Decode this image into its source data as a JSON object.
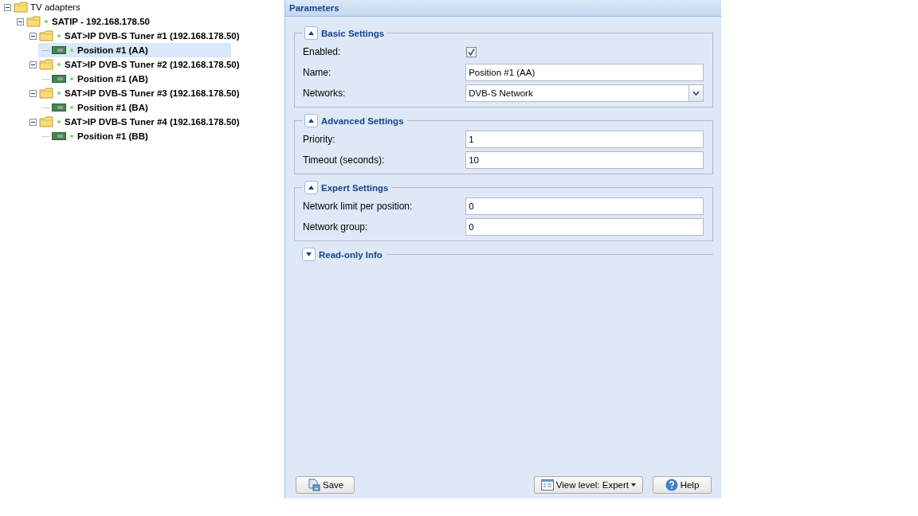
{
  "tree": [
    {
      "label": "TV adapters",
      "kind": "folder",
      "expanded": true,
      "selected": false,
      "online": false,
      "children": [
        {
          "label": "SATIP - 192.168.178.50",
          "kind": "folder",
          "expanded": true,
          "selected": false,
          "online": true,
          "children": [
            {
              "label": "SAT>IP DVB-S Tuner #1 (192.168.178.50)",
              "kind": "folder",
              "expanded": true,
              "selected": false,
              "online": true,
              "children": [
                {
                  "label": "Position #1 (AA)",
                  "kind": "card",
                  "selected": true,
                  "online": true
                }
              ]
            },
            {
              "label": "SAT>IP DVB-S Tuner #2 (192.168.178.50)",
              "kind": "folder",
              "expanded": true,
              "selected": false,
              "online": true,
              "children": [
                {
                  "label": "Position #1 (AB)",
                  "kind": "card",
                  "selected": false,
                  "online": true
                }
              ]
            },
            {
              "label": "SAT>IP DVB-S Tuner #3 (192.168.178.50)",
              "kind": "folder",
              "expanded": true,
              "selected": false,
              "online": true,
              "children": [
                {
                  "label": "Position #1 (BA)",
                  "kind": "card",
                  "selected": false,
                  "online": true
                }
              ]
            },
            {
              "label": "SAT>IP DVB-S Tuner #4 (192.168.178.50)",
              "kind": "folder",
              "expanded": true,
              "selected": false,
              "online": true,
              "children": [
                {
                  "label": "Position #1 (BB)",
                  "kind": "card",
                  "selected": false,
                  "online": true
                }
              ]
            }
          ]
        }
      ]
    }
  ],
  "panel": {
    "title": "Parameters",
    "sections": [
      {
        "title": "Basic Settings",
        "expanded": true,
        "fields": [
          {
            "label": "Enabled:",
            "kind": "checkbox",
            "checked": true
          },
          {
            "label": "Name:",
            "kind": "text",
            "value": "Position #1 (AA)"
          },
          {
            "label": "Networks:",
            "kind": "select",
            "value": "DVB-S Network"
          }
        ]
      },
      {
        "title": "Advanced Settings",
        "expanded": true,
        "fields": [
          {
            "label": "Priority:",
            "kind": "text",
            "value": "1"
          },
          {
            "label": "Timeout (seconds):",
            "kind": "text",
            "value": "10"
          }
        ]
      },
      {
        "title": "Expert Settings",
        "expanded": true,
        "fields": [
          {
            "label": "Network limit per position:",
            "kind": "text",
            "value": "0"
          },
          {
            "label": "Network group:",
            "kind": "text",
            "value": "0"
          }
        ]
      },
      {
        "title": "Read-only Info",
        "expanded": false
      }
    ],
    "buttons": {
      "save": "Save",
      "view_level": "View level: Expert",
      "help": "Help"
    }
  }
}
